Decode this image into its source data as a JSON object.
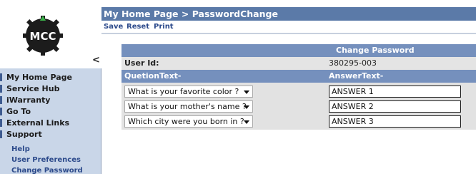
{
  "logo": {
    "text": "MCC"
  },
  "collapse_glyph": "<",
  "nav": {
    "items": [
      {
        "label": "My Home Page"
      },
      {
        "label": "Service Hub"
      },
      {
        "label": "iWarranty"
      },
      {
        "label": "Go To"
      },
      {
        "label": "External Links"
      },
      {
        "label": "Support"
      }
    ],
    "subitems": [
      {
        "label": "Help"
      },
      {
        "label": "User Preferences"
      },
      {
        "label": "Change Password"
      }
    ]
  },
  "header": {
    "breadcrumb": "My Home Page  >  PasswordChange"
  },
  "toolbar": {
    "save_label": "Save",
    "reset_label": "Reset",
    "print_label": "Print"
  },
  "form": {
    "title": "Change Password",
    "user_id_label": "User Id:",
    "user_id_value": "380295-003",
    "question_header": "QuetionText-",
    "answer_header": "AnswerText-",
    "rows": [
      {
        "question": "What is your favorite color ?",
        "answer": "ANSWER 1"
      },
      {
        "question": "What is your mother's name ?",
        "answer": "ANSWER 2"
      },
      {
        "question": "Which city were you born in ?",
        "answer": "ANSWER 3"
      }
    ]
  },
  "colors": {
    "header_bar": "#5b7aa8",
    "panel_header": "#7590bd",
    "nav_bg": "#c9d6e8",
    "link": "#2c4a8b"
  }
}
